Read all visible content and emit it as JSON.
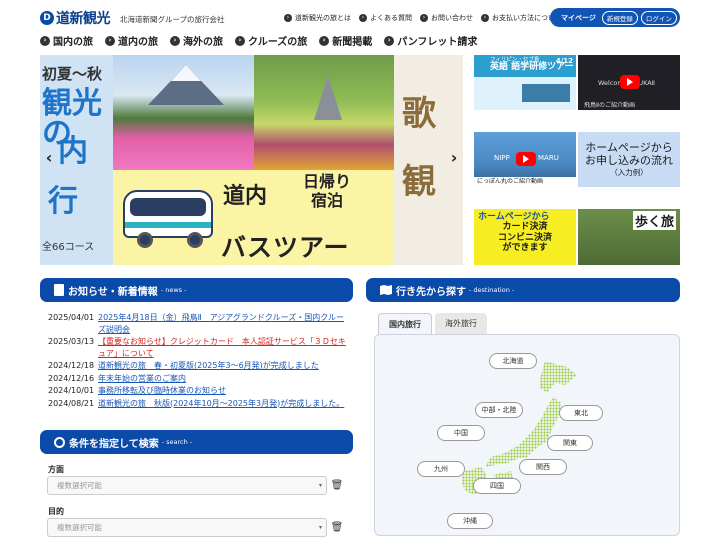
{
  "header": {
    "logo_mark": "D",
    "logo_text": "道新観光",
    "tagline": "北海道新聞グループの旅行会社",
    "links": [
      "道新観光の旅とは",
      "よくある質問",
      "お問い合わせ",
      "お支払い方法について"
    ],
    "mypage_label": "マイページ",
    "register_label": "新規登録",
    "login_label": "ログイン"
  },
  "main_nav": [
    "国内の旅",
    "道内の旅",
    "海外の旅",
    "クルーズの旅",
    "新聞掲載",
    "パンフレット請求"
  ],
  "hero": {
    "left_slide": {
      "line1": "初夏～秋",
      "line2": "観光の",
      "line3": "内",
      "line4": "行",
      "count": "全66コース"
    },
    "bus_tour": {
      "word_a": "道内",
      "word_b1": "日帰り",
      "word_b2": "宿泊",
      "word_c": "バスツアー"
    },
    "right_slide": {
      "line1": "歌",
      "line2": "観"
    },
    "prev_arrow": "‹",
    "next_arrow": "›"
  },
  "thumbs": {
    "t1_title": "英語",
    "t1_sub": "フィリピン・セブ島",
    "t1_line2": "語学研修ツアー",
    "t1_date": "4/12",
    "t2_caption": "飛鳥Ⅱのご紹介動画",
    "t2_title": "Welcome ASUKAⅡ",
    "t3_text_left": "NIPP",
    "t3_text_right": "MARU",
    "t3_caption": "にっぽん丸のご紹介動画",
    "t4_line1": "ホームページから",
    "t4_line2": "お申し込みの流れ",
    "t4_line3": "（入力例）",
    "t5_line1": "ホームページから",
    "t5_line2": "カード決済",
    "t5_line3": "コンビニ決済",
    "t5_line4": "ができます",
    "t6_title": "歩く旅"
  },
  "news": {
    "title": "お知らせ・新着情報",
    "sub": "- news -",
    "items": [
      {
        "date": "2025/04/01",
        "text": "2025年4月18日（金）飛鳥Ⅱ　アジアグランドクルーズ・国内クルーズ説明会"
      },
      {
        "date": "2025/03/13",
        "text": "【重要なお知らせ】クレジットカード　本人認証サービス「３Ｄセキュア」について"
      },
      {
        "date": "2024/12/18",
        "text": "道新観光の旅　春・初夏版(2025年3～6月発)が完成しました"
      },
      {
        "date": "2024/12/16",
        "text": "年末年始の営業のご案内"
      },
      {
        "date": "2024/10/01",
        "text": "事務所移転及び臨時休業のお知らせ"
      },
      {
        "date": "2024/08/21",
        "text": "道新観光の旅　秋版(2024年10月～2025年3月発)が完成しました。"
      }
    ]
  },
  "search": {
    "title": "条件を指定して検索",
    "sub": "- search -",
    "field1_label": "方面",
    "field1_placeholder": "複数選択可能",
    "field2_label": "目的",
    "field2_placeholder": "複数選択可能"
  },
  "destination": {
    "title": "行き先から探す",
    "sub": "- destination -",
    "tabs": [
      "国内旅行",
      "海外旅行"
    ],
    "regions": [
      "北海道",
      "中部・北陸",
      "東北",
      "関東",
      "中国",
      "九州",
      "関西",
      "四国",
      "沖縄"
    ]
  },
  "colors": {
    "brand_blue": "#0a4aa8",
    "news_link": "#1a56b8",
    "alert_red": "#d9251d"
  }
}
